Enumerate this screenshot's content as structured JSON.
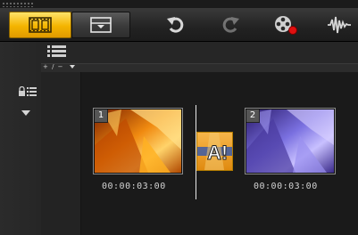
{
  "toolbar": {
    "buttons": [
      {
        "name": "storyboard-view",
        "icon": "filmstrip-icon",
        "active": true
      },
      {
        "name": "timeline-view",
        "icon": "timeline-icon",
        "active": false
      },
      {
        "name": "undo",
        "icon": "undo-icon",
        "enabled": true
      },
      {
        "name": "redo",
        "icon": "redo-icon",
        "enabled": false
      },
      {
        "name": "record-capture",
        "icon": "film-reel-record-icon"
      },
      {
        "name": "audio-mixer",
        "icon": "audio-waveform-icon"
      }
    ]
  },
  "zoom": {
    "label": "+ / −"
  },
  "clips": [
    {
      "number": "1",
      "duration": "00:00:03:00"
    },
    {
      "number": "2",
      "duration": "00:00:03:00"
    }
  ],
  "transition": {
    "icon": "text-transition-icon",
    "label": "A!"
  },
  "colors": {
    "accent": "#f4b400",
    "background": "#1a1a1a",
    "panel": "#262626"
  }
}
